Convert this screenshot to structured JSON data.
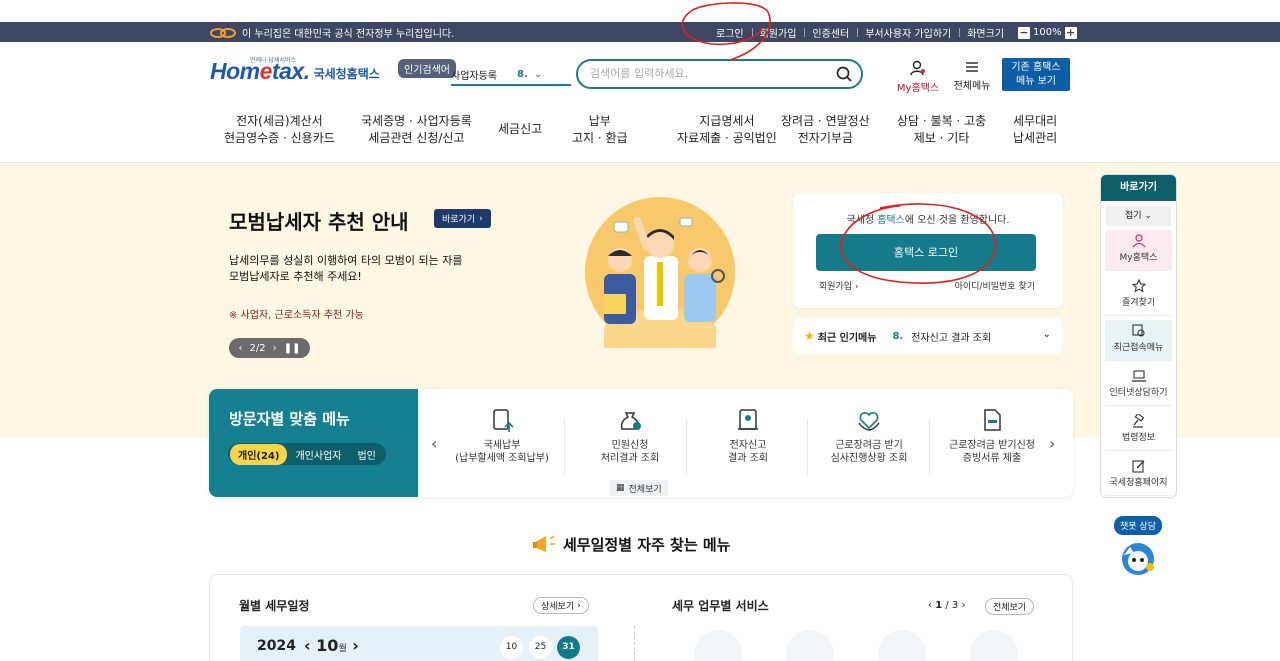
{
  "govbar": {
    "notice": "이 누리집은 대한민국 공식 전자정부 누리집입니다.",
    "links": [
      "로그인",
      "회원가입",
      "인증센터",
      "부서사용자 가입하기",
      "화면크기"
    ],
    "zoom": "100%",
    "zoom_minus": "−",
    "zoom_plus": "+"
  },
  "header": {
    "logo_tagline": "언제나 납세서비스",
    "logo_mark": "Hometax",
    "logo_name": "국세청홈택스",
    "popular_pill": "인기검색어",
    "select_label": "사업자등록",
    "select_num": "8.",
    "select_trail": "$",
    "search_placeholder": "검색어를 입력하세요.",
    "my_hometax": "My홈택스",
    "all_menu": "전체메뉴",
    "old_view": [
      "기존 홈택스",
      "메뉴 보기"
    ]
  },
  "gnb": [
    [
      "전자(세금)계산서",
      "현금영수증 · 신용카드"
    ],
    [
      "국세증명 · 사업자등록",
      "세금관련 신청/신고"
    ],
    [
      "세금신고"
    ],
    [
      "납부",
      "고지 · 환급"
    ],
    [
      "지급명세서",
      "자료제출 · 공익법인"
    ],
    [
      "장려금 · 연말정산",
      "전자기부금"
    ],
    [
      "상담 · 불복 · 고충",
      "제보 · 기타"
    ],
    [
      "세무대리",
      "납세관리"
    ]
  ],
  "hero": {
    "title": "모범납세자 추천 안내",
    "shortcut": "바로가기",
    "desc1": "납세의무를 성실히 이행하여 타의 모범이 되는 자를",
    "desc2": "모범납세자로 추천해 주세요!",
    "note": "※ 사업자, 근로소득자 추천 가능",
    "pager": "2/2"
  },
  "login": {
    "welcome_pre": "국세청 ",
    "welcome_hl": "홈택스",
    "welcome_post": "에 오신 것을 환영합니다.",
    "button": "홈택스 로그인",
    "join": "회원가입",
    "find": "아이디/비밀번호 찾기"
  },
  "popular_menu": {
    "label": "최근 인기메뉴",
    "num": "8.",
    "item": "전자신고 결과 조회"
  },
  "visitor": {
    "title": "방문자별 맞춤 메뉴",
    "tabs": [
      "개인(24)",
      "개인사업자",
      "법인"
    ],
    "items": [
      [
        "국세납부",
        "(납부할세액 조회납부)"
      ],
      [
        "민원신청",
        "처리결과 조회"
      ],
      [
        "전자신고",
        "결과 조회"
      ],
      [
        "근로장려금 받기",
        "심사진행상황 조회"
      ],
      [
        "근로장려금 받기신청",
        "증빙서류 제출"
      ]
    ],
    "all_view": "전체보기"
  },
  "quick": {
    "header": "바로가기",
    "fold": "접기",
    "items": [
      "My홈택스",
      "즐겨찾기",
      "최근접속메뉴",
      "인터넷상담하기",
      "법령정보",
      "국세청홈페이지"
    ]
  },
  "chatbot": {
    "label": "챗봇 상담"
  },
  "section": {
    "title": "세무일정별 자주 찾는 메뉴"
  },
  "calendar": {
    "title": "월별 세무일정",
    "detail": "상세보기",
    "year": "2024",
    "month": "10",
    "month_unit": "월",
    "days": [
      "10",
      "25",
      "31"
    ]
  },
  "services": {
    "title": "세무 업무별 서비스",
    "page_current": "1",
    "page_total": "/ 3",
    "all_view": "전체보기"
  },
  "colors": {
    "teal": "#157b8a",
    "navy_bar": "#3e4661",
    "hero_bg": "#fdf7e4",
    "annotation_red": "#e0201c"
  }
}
